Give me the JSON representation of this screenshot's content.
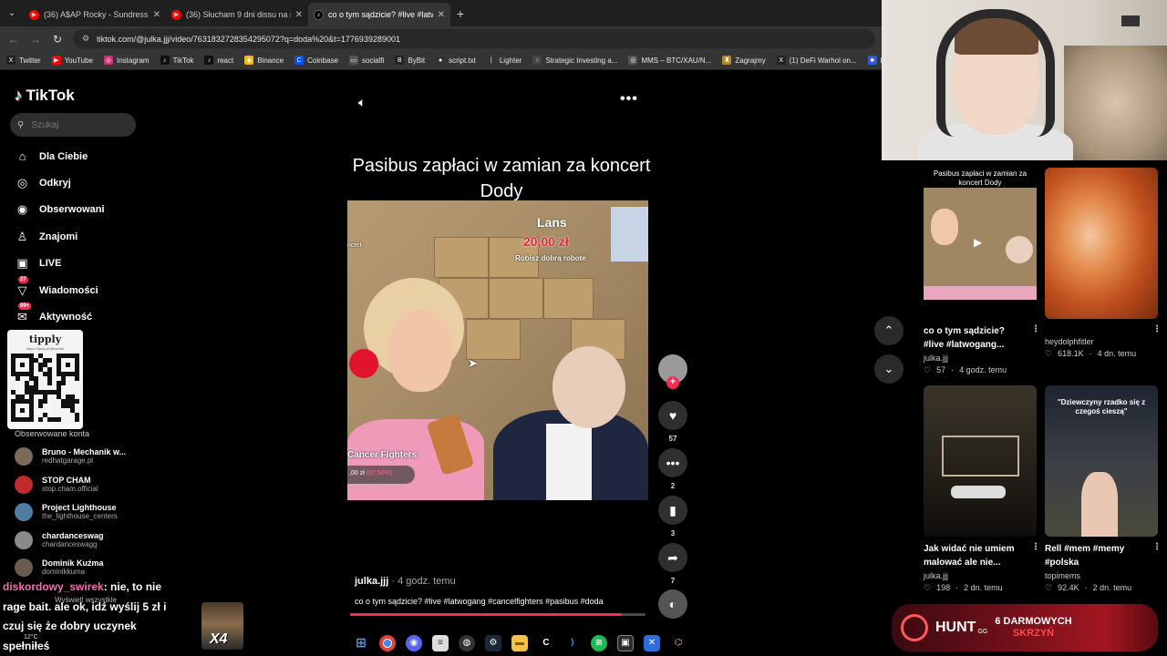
{
  "browser": {
    "tabs": [
      {
        "label": "(36) A$AP Rocky - Sundress (Of",
        "icon": "youtube-icon",
        "color": "#ff0000",
        "active": false
      },
      {
        "label": "(36) Słucham 9 dni dissu na rak",
        "icon": "youtube-icon",
        "color": "#ff0000",
        "active": false
      },
      {
        "label": "co o tym sądzicie? #live #latwo",
        "icon": "tiktok-icon",
        "color": "#000000",
        "active": true
      }
    ],
    "url": "tiktok.com/@julka.jjj/video/7631832728354295072?q=doda%20&t=1776939289001",
    "bookmarks": [
      {
        "label": "Twitter",
        "glyph": "X",
        "color": "#222"
      },
      {
        "label": "YouTube",
        "glyph": "▶",
        "color": "#ff0000"
      },
      {
        "label": "Instagram",
        "glyph": "◎",
        "color": "#d62976"
      },
      {
        "label": "TikTok",
        "glyph": "♪",
        "color": "#111"
      },
      {
        "label": "react",
        "glyph": "♪",
        "color": "#111"
      },
      {
        "label": "Binance",
        "glyph": "◆",
        "color": "#f0b90b"
      },
      {
        "label": "Coinbase",
        "glyph": "C",
        "color": "#0052ff"
      },
      {
        "label": "socialfi",
        "glyph": "▭",
        "color": "#555"
      },
      {
        "label": "ByBit",
        "glyph": "B",
        "color": "#222"
      },
      {
        "label": "script.txt",
        "glyph": "●",
        "color": "#333"
      },
      {
        "label": "Lighter",
        "glyph": "|",
        "color": "#333"
      },
      {
        "label": "Strategic Investing a...",
        "glyph": "○",
        "color": "#444"
      },
      {
        "label": "MMS – BTC/XAU/N...",
        "glyph": "◎",
        "color": "#555"
      },
      {
        "label": "Zagrajmy",
        "glyph": "♜",
        "color": "#b5892b"
      },
      {
        "label": "(1) DeFi Warhol on...",
        "glyph": "X",
        "color": "#222"
      },
      {
        "label": "Po",
        "glyph": "■",
        "color": "#2b5cd6"
      }
    ]
  },
  "sidebar": {
    "logo": "TikTok",
    "search_placeholder": "Szukaj",
    "nav": [
      {
        "label": "Dla Ciebie",
        "icon": "home-icon",
        "glyph": "⌂",
        "badge": ""
      },
      {
        "label": "Odkryj",
        "icon": "compass-icon",
        "glyph": "◎",
        "badge": ""
      },
      {
        "label": "Obserwowani",
        "icon": "following-avatar-icon",
        "glyph": "◉",
        "badge": ""
      },
      {
        "label": "Znajomi",
        "icon": "friends-icon",
        "glyph": "♙",
        "badge": ""
      },
      {
        "label": "LIVE",
        "icon": "live-icon",
        "glyph": "▣",
        "badge": ""
      },
      {
        "label": "Wiadomości",
        "icon": "messages-icon",
        "glyph": "▽",
        "badge": "27"
      },
      {
        "label": "Aktywność",
        "icon": "activity-icon",
        "glyph": "✉",
        "badge": "99+"
      }
    ],
    "qr": {
      "title": "tipply",
      "subtitle": "https://tipply.pl/@swirek"
    },
    "following_title": "Obserwowane konta",
    "following": [
      {
        "name": "Bruno - Mechanik w...",
        "handle": "redhatgarage.pl",
        "color": "#7b6a5a"
      },
      {
        "name": "STOP CHAM",
        "handle": "stop.cham.official",
        "color": "#c22b2b"
      },
      {
        "name": "Project Lighthouse",
        "handle": "the_lighthouse_centers",
        "color": "#4e7fa3"
      },
      {
        "name": "chardanceswag",
        "handle": "chardanceswagg",
        "color": "#8a8a8a"
      },
      {
        "name": "Dominik Kuźma",
        "handle": "dominikkuma",
        "color": "#6b5b4d"
      }
    ],
    "show_all": "Wyświetl wszystkie"
  },
  "chat": {
    "username": "diskordowy_swirek",
    "message": ": nie, to nie rage bait. ale ok, idź wyślij 5 zł i czuj się że dobry uczynek spełniłeś",
    "emote_text": "X4"
  },
  "video": {
    "title": "Pasibus zapłaci w zamian za koncert Dody",
    "overlay_lans": "Lans",
    "overlay_amount": "20,00 zł",
    "overlay_subtitle": "Robisz dobrą robote",
    "overlay_concert": "ncert",
    "overlay_cf": "Cancer Fighters",
    "overlay_cf_amount": ",00 zł",
    "overlay_cf_red": "(87,50%)",
    "author": "julka.jjj",
    "time": "4 godz. temu",
    "caption": "co o tym sądzicie? #live #latwogang #cancelfighters #pasibus #doda",
    "progress": 0.92,
    "likes": "57",
    "comments": "2",
    "saves": "3",
    "shares": "7"
  },
  "recommended": [
    {
      "title": "co o tym sądzicie? #live #latwogang...",
      "author": "julka.jjj",
      "likes": "57",
      "time": "4 godz. temu",
      "thumb_caption": "Pasibus zapłaci w zamian za koncert Dody"
    },
    {
      "title": "",
      "author": "heydolphfitler",
      "likes": "618.1K",
      "time": "4 dn. temu",
      "thumb_caption": ""
    },
    {
      "title": "Jak widać nie umiem malować ale nie...",
      "author": "julka.jjj",
      "likes": "198",
      "time": "2 dn. temu",
      "thumb_caption": ""
    },
    {
      "title": "Rell #mem #memy #polska",
      "author": "topimems",
      "likes": "92.4K",
      "time": "2 dn. temu",
      "thumb_caption": "\"Dziewczyny rzadko się z czegoś cieszą\""
    }
  ],
  "promo": {
    "brand": "HUNT",
    "suffix": "GG",
    "line1": "6 DARMOWYCH",
    "line2": "SKRZYŃ"
  },
  "weather": "12°C"
}
